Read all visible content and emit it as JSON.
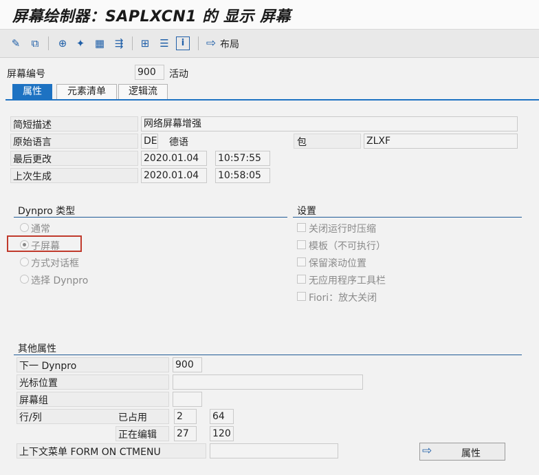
{
  "window": {
    "title": "屏幕绘制器：SAPLXCN1 的 显示 屏幕"
  },
  "toolbar": {
    "icons": [
      "edit-toggle-icon",
      "other-object-icon",
      "check-icon",
      "activate-icon",
      "test-icon",
      "where-used-icon",
      "hierarchy-icon",
      "element-list-icon",
      "info-icon",
      "layout-arrow-icon"
    ],
    "layout_label": "布局"
  },
  "screen": {
    "number_label": "屏幕编号",
    "number": "900",
    "status": "活动"
  },
  "tabs": [
    {
      "label": "属性",
      "active": true
    },
    {
      "label": "元素清单",
      "active": false
    },
    {
      "label": "逻辑流",
      "active": false
    }
  ],
  "attributes": {
    "short_desc_label": "简短描述",
    "short_desc": "网络屏幕增强",
    "orig_lang_label": "原始语言",
    "orig_lang_code": "DE",
    "orig_lang_name": "德语",
    "package_label": "包",
    "package": "ZLXF",
    "last_changed_label": "最后更改",
    "last_changed_date": "2020.01.04",
    "last_changed_time": "10:57:55",
    "last_generated_label": "上次生成",
    "last_generated_date": "2020.01.04",
    "last_generated_time": "10:58:05"
  },
  "dynpro_type": {
    "title": "Dynpro 类型",
    "options": [
      {
        "label": "通常",
        "selected": false
      },
      {
        "label": "子屏幕",
        "selected": true
      },
      {
        "label": "方式对话框",
        "selected": false
      },
      {
        "label": "选择 Dynpro",
        "selected": false
      }
    ]
  },
  "settings": {
    "title": "设置",
    "options": [
      {
        "label": "关闭运行时压缩",
        "checked": false
      },
      {
        "label": "模板（不可执行）",
        "checked": false
      },
      {
        "label": "保留滚动位置",
        "checked": false
      },
      {
        "label": "无应用程序工具栏",
        "checked": false
      },
      {
        "label": "Fiori：放大关闭",
        "checked": false
      }
    ]
  },
  "other": {
    "title": "其他属性",
    "next_dynpro_label": "下一 Dynpro",
    "next_dynpro": "900",
    "cursor_label": "光标位置",
    "cursor": "",
    "screen_group_label": "屏幕组",
    "screen_group": "",
    "rowcol_label": "行/列",
    "occupied_label": "已占用",
    "occupied_row": "2",
    "occupied_col": "64",
    "editing_label": "正在编辑",
    "editing_row": "27",
    "editing_col": "120",
    "context_menu_label": "上下文菜单 FORM ON CTMENU",
    "context_menu": "",
    "attr_button_label": "属性"
  },
  "colors": {
    "accent": "#1d72c2",
    "highlight_box": "#c0392b"
  }
}
